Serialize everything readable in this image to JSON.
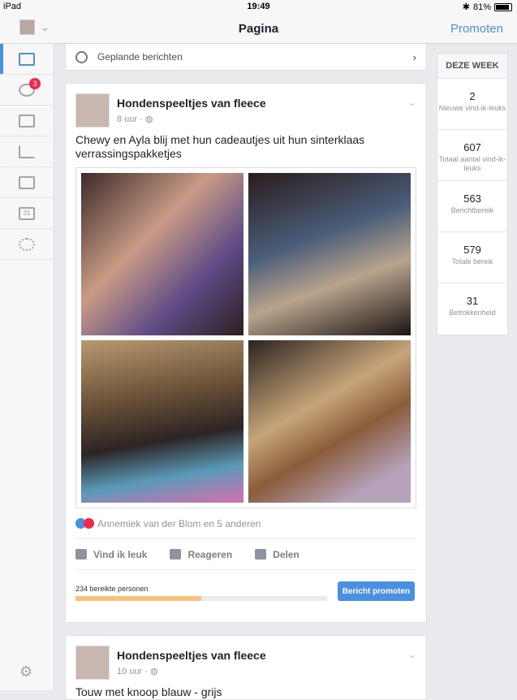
{
  "status_bar": {
    "device": "iPad",
    "time": "19:49",
    "battery": "81%"
  },
  "nav": {
    "title": "Pagina",
    "promote": "Promoten"
  },
  "sidebar": {
    "notifications_badge": "3",
    "calendar_day": "31"
  },
  "scheduled": {
    "label": "Geplande berichten"
  },
  "post": {
    "page_name": "Hondenspeeltjes van fleece",
    "time": "8 uur",
    "text": "Chewy en Ayla blij met hun cadeautjes uit hun sinterklaas verrassingspakketjes",
    "reactions_text": "Annemiek van der Blom en 5 anderen",
    "actions": {
      "like": "Vind ik leuk",
      "comment": "Reageren",
      "share": "Delen"
    },
    "reach_text": "234 bereikte personen",
    "reach_fraction": 0.5,
    "boost_label": "Bericht promoten"
  },
  "post2": {
    "page_name": "Hondenspeeltjes van fleece",
    "time": "10 uur",
    "text": "Touw met knoop blauw - grijs"
  },
  "week": {
    "header": "DEZE WEEK",
    "stats": [
      {
        "value": "2",
        "label": "Nieuwe vind-ik-leuks"
      },
      {
        "value": "607",
        "label": "Totaal aantal vind-ik-leuks"
      },
      {
        "value": "563",
        "label": "Berichtbereik"
      },
      {
        "value": "579",
        "label": "Totale bereik"
      },
      {
        "value": "31",
        "label": "Betrokkenheid"
      }
    ]
  },
  "colors": {
    "accent": "#4a90e2",
    "reach_fill": "#f7c07c",
    "badge": "#f02849"
  }
}
